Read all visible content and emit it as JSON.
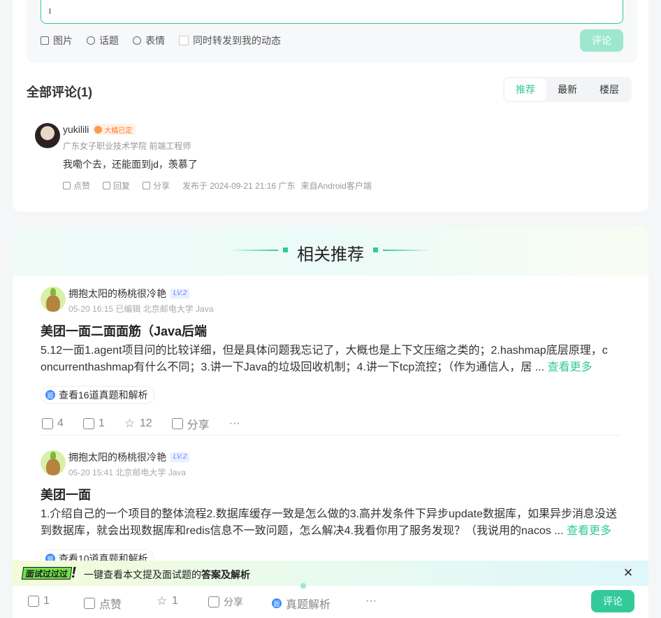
{
  "editor": {
    "toolbar": [
      {
        "label": "图片",
        "icon": "image-icon"
      },
      {
        "label": "话题",
        "icon": "topic-icon"
      },
      {
        "label": "表情",
        "icon": "emoji-icon"
      }
    ],
    "repost_label": "同时转发到我的动态",
    "submit_label": "评论"
  },
  "comments": {
    "title": "全部评论(1)",
    "sort_tabs": [
      "推荐",
      "最新",
      "楼层"
    ],
    "active_tab": "推荐",
    "items": [
      {
        "user": "yukilili",
        "badge": "大橘已定",
        "subtitle": "广东女子职业技术学院 前端工程师",
        "text": "我嘞个去，还能面到jd，羡慕了",
        "actions": [
          "点赞",
          "回复",
          "分享"
        ],
        "meta": "发布于 2024-09-21 21:16 广东",
        "client": "来自Android客户端"
      }
    ]
  },
  "related": {
    "title": "相关推荐",
    "posts": [
      {
        "author": "拥抱太阳的杨桃很冷艳",
        "level": "LV.2",
        "meta": "05-20 16:15  已编辑  北京邮电大学 Java",
        "title": "美团一面二面面筋（Java后端",
        "body_line1": "5.12一面1.agent项目问的比较详细，但是具体问题我忘记了，大概也是上下文压缩之类的；2.hashmap底层原理，c",
        "body_line2": "oncurrenthashmap有什么不同；3.讲一下Java的垃圾回收机制；4.讲一下tcp流控；（作为通信人，居 ... ",
        "more": "查看更多",
        "question_link": "查看16道真题和解析",
        "likes": "4",
        "comments": "1",
        "stars": "12",
        "share": "分享"
      },
      {
        "author": "拥抱太阳的杨桃很冷艳",
        "level": "LV.2",
        "meta": "05-20 15:41  北京邮电大学 Java",
        "title": "美团一面",
        "body_line1": "1.介绍自己的一个项目的整体流程2.数据库缓存一致是怎么做的3.高并发条件下异步update数据库，如果异步消息没送",
        "body_line2": "到数据库，就会出现数据库和redis信息不一致问题，怎么解决4.我看你用了服务发现？（我说用的nacos ... ",
        "more": "查看更多",
        "question_link": "查看10道真题和解析"
      }
    ]
  },
  "promo": {
    "tag": "面试过过过",
    "excl": "!",
    "text_prefix": "一键查看本文提及面试题的",
    "text_bold": "答案及解析"
  },
  "bottom_bar": {
    "comments": "1",
    "like_label": "点赞",
    "stars": "1",
    "share_label": "分享",
    "analysis_label": "真题解析",
    "more": "···",
    "comment_btn": "评论"
  },
  "colors": {
    "accent": "#32ca99",
    "accent_light": "#9de7cf",
    "level_blue": "#5b8cff",
    "badge_orange": "#ff7a2f"
  }
}
